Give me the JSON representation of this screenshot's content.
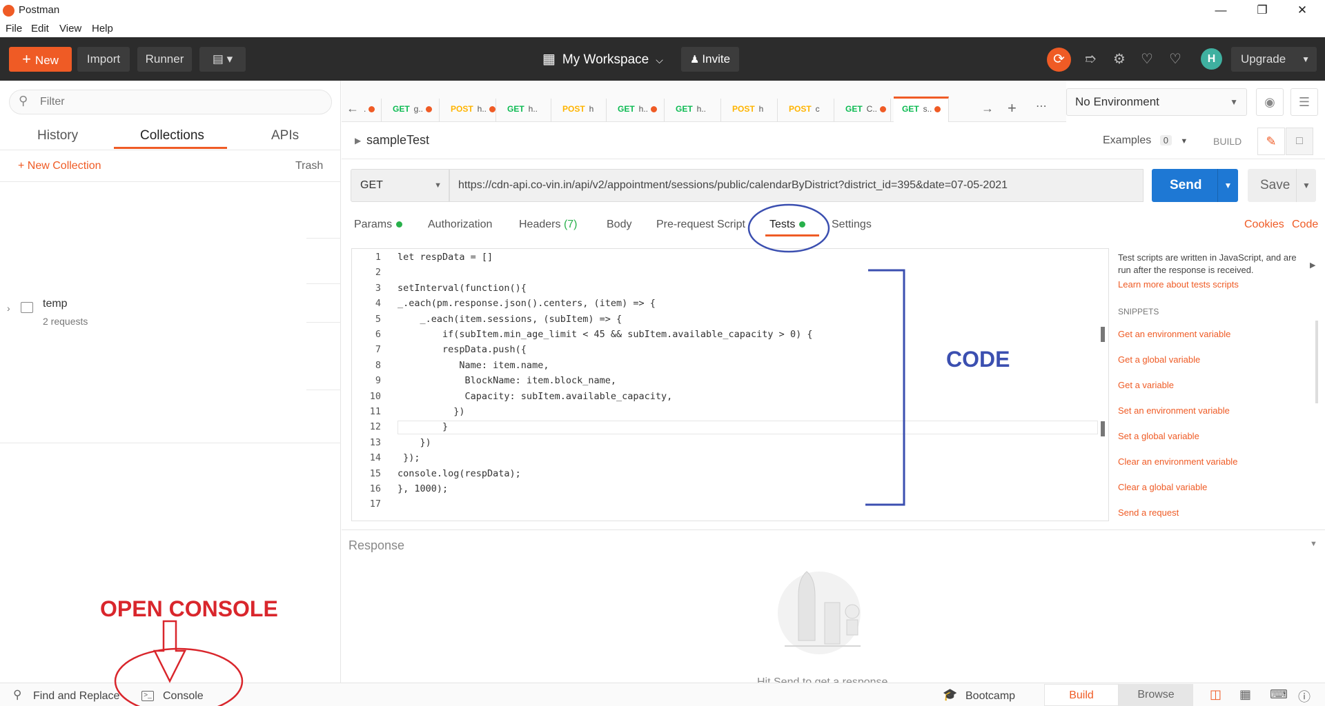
{
  "app_title": "Postman",
  "menu": [
    "File",
    "Edit",
    "View",
    "Help"
  ],
  "header": {
    "new_label": "New",
    "import_label": "Import",
    "runner_label": "Runner",
    "workspace_label": "My Workspace",
    "invite_label": "Invite",
    "upgrade_label": "Upgrade",
    "avatar_initial": "H"
  },
  "sidebar": {
    "filter_placeholder": "Filter",
    "tabs": [
      "History",
      "Collections",
      "APIs"
    ],
    "new_collection_label": "+ New Collection",
    "trash_label": "Trash",
    "collection": {
      "name": "temp",
      "subtitle": "2 requests"
    }
  },
  "request_tabs": [
    {
      "method": "",
      "label": ".",
      "unsaved": true
    },
    {
      "method": "GET",
      "label": "g..",
      "unsaved": true
    },
    {
      "method": "POST",
      "label": "h..",
      "unsaved": true
    },
    {
      "method": "GET",
      "label": "h..",
      "unsaved": false
    },
    {
      "method": "POST",
      "label": "h",
      "unsaved": false
    },
    {
      "method": "GET",
      "label": "h..",
      "unsaved": true
    },
    {
      "method": "GET",
      "label": "h..",
      "unsaved": false
    },
    {
      "method": "POST",
      "label": "h",
      "unsaved": false
    },
    {
      "method": "POST",
      "label": "c",
      "unsaved": false
    },
    {
      "method": "GET",
      "label": "C..",
      "unsaved": true
    },
    {
      "method": "GET",
      "label": "s..",
      "unsaved": true
    }
  ],
  "environment": {
    "selected": "No Environment"
  },
  "request": {
    "name": "sampleTest",
    "examples_label": "Examples",
    "examples_count": "0",
    "build_label": "BUILD",
    "method": "GET",
    "url": "https://cdn-api.co-vin.in/api/v2/appointment/sessions/public/calendarByDistrict?district_id=395&date=07-05-2021",
    "send_label": "Send",
    "save_label": "Save"
  },
  "sub_tabs": {
    "params": "Params",
    "authorization": "Authorization",
    "headers": "Headers",
    "headers_count": "(7)",
    "body": "Body",
    "prerequest": "Pre-request Script",
    "tests": "Tests",
    "settings": "Settings",
    "cookies": "Cookies",
    "code": "Code"
  },
  "code_lines": [
    "let respData = []",
    "",
    "setInterval(function(){",
    "_.each(pm.response.json().centers, (item) => {",
    "    _.each(item.sessions, (subItem) => {",
    "        if(subItem.min_age_limit < 45 && subItem.available_capacity > 0) {",
    "        respData.push({",
    "           Name: item.name,",
    "            BlockName: item.block_name,",
    "            Capacity: subItem.available_capacity,",
    "          })",
    "        }",
    "    })",
    " });",
    "console.log(respData);",
    "}, 1000);",
    ""
  ],
  "snippets": {
    "description": "Test scripts are written in JavaScript, and are run after the response is received.",
    "learn_more": "Learn more about tests scripts",
    "heading": "SNIPPETS",
    "items": [
      "Get an environment variable",
      "Get a global variable",
      "Get a variable",
      "Set an environment variable",
      "Set a global variable",
      "Clear an environment variable",
      "Clear a global variable",
      "Send a request"
    ]
  },
  "response": {
    "title": "Response",
    "empty_hint": "Hit Send to get a response"
  },
  "footer": {
    "find_replace": "Find and Replace",
    "console": "Console",
    "bootcamp": "Bootcamp",
    "build": "Build",
    "browse": "Browse"
  },
  "annotations": {
    "code": "CODE",
    "open_console": "OPEN CONSOLE"
  },
  "colors": {
    "accent": "#ef5b25",
    "send": "#1e78d4",
    "annotation_blue": "#3b4fb0",
    "annotation_red": "#d9262c"
  }
}
